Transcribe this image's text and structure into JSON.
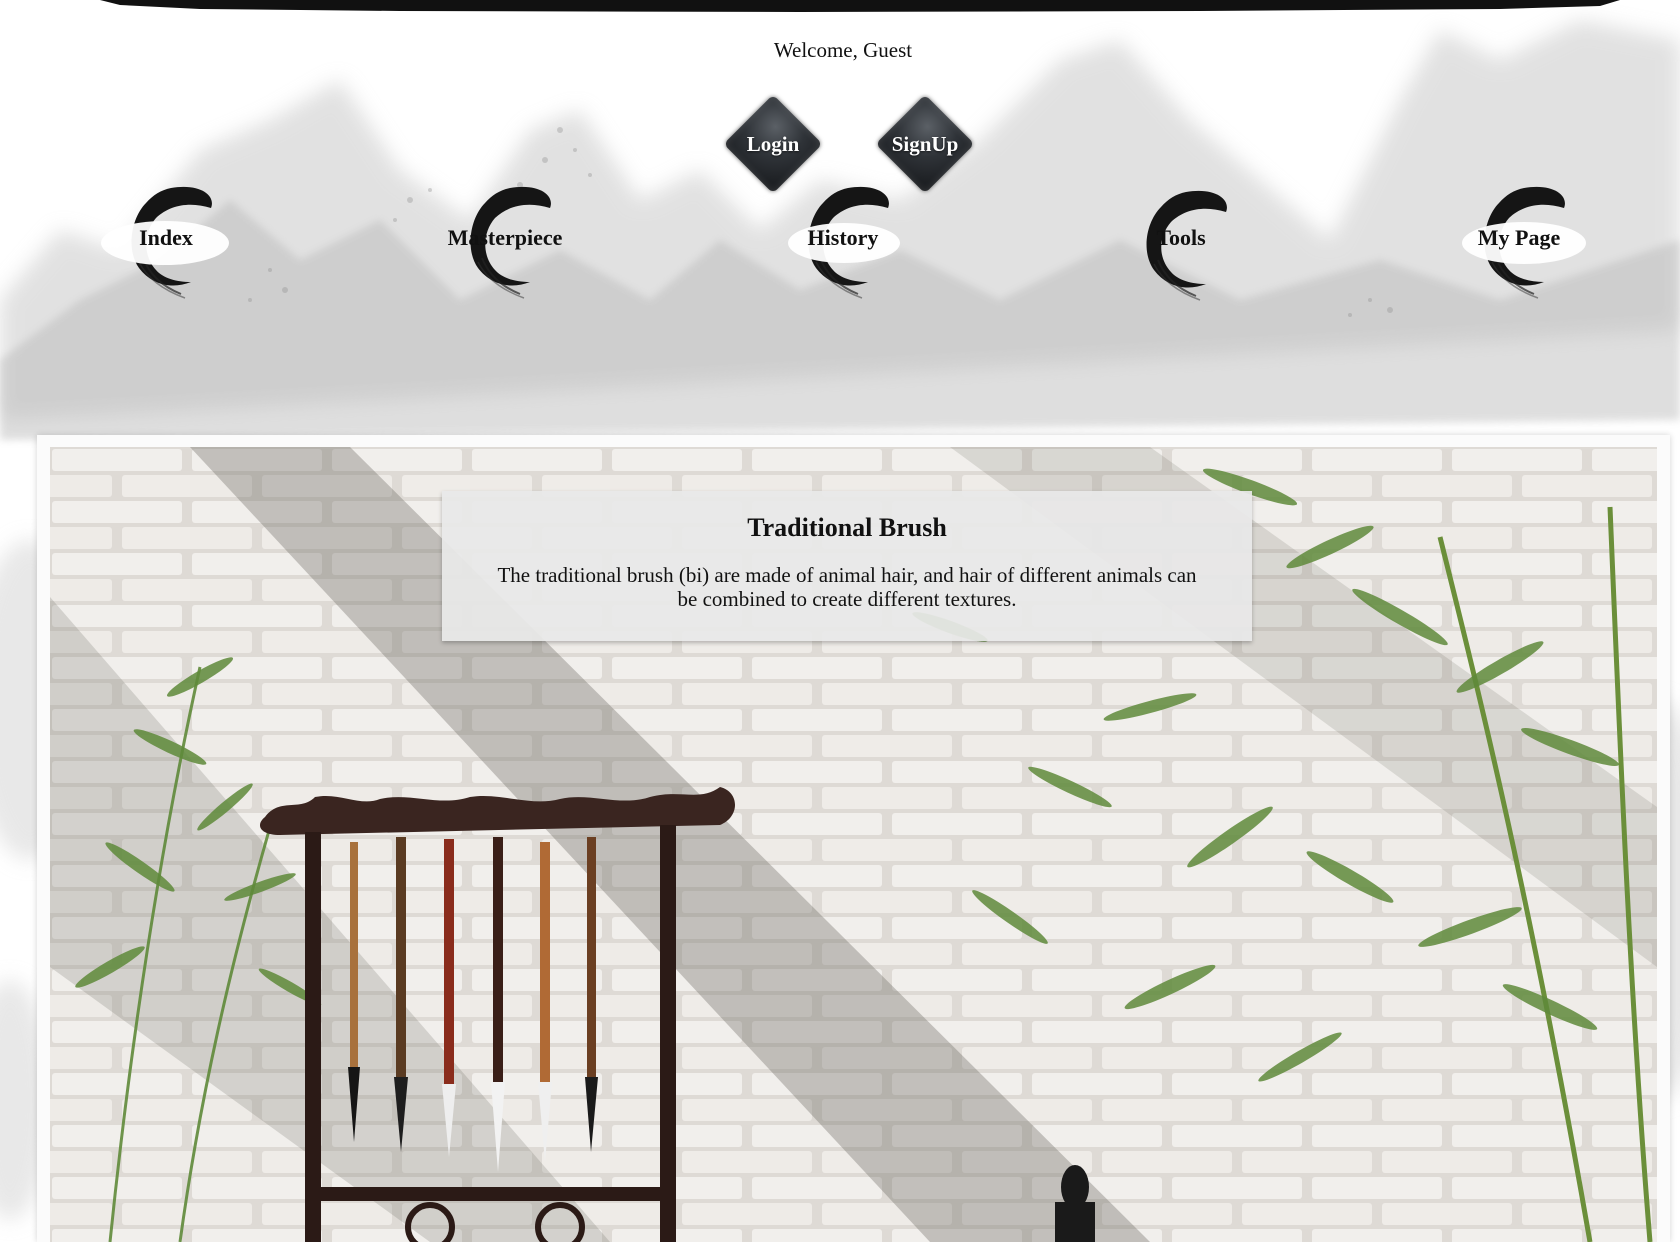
{
  "header": {
    "welcome_text": "Welcome, Guest",
    "login_label": "Login",
    "signup_label": "SignUp"
  },
  "nav": {
    "items": [
      {
        "label": "Index"
      },
      {
        "label": "Masterpiece"
      },
      {
        "label": "History"
      },
      {
        "label": "Tools"
      },
      {
        "label": "My Page"
      }
    ]
  },
  "feature": {
    "title": "Traditional Brush",
    "description": "The traditional brush (bi) are made of animal hair, and hair of different animals can be combined to create different textures."
  },
  "colors": {
    "ink": "#111111",
    "button_dark": "#2f3338",
    "caption_bg": "#e8e8e8",
    "wall": "#e6e3df",
    "bamboo": "#5f8a3a"
  }
}
